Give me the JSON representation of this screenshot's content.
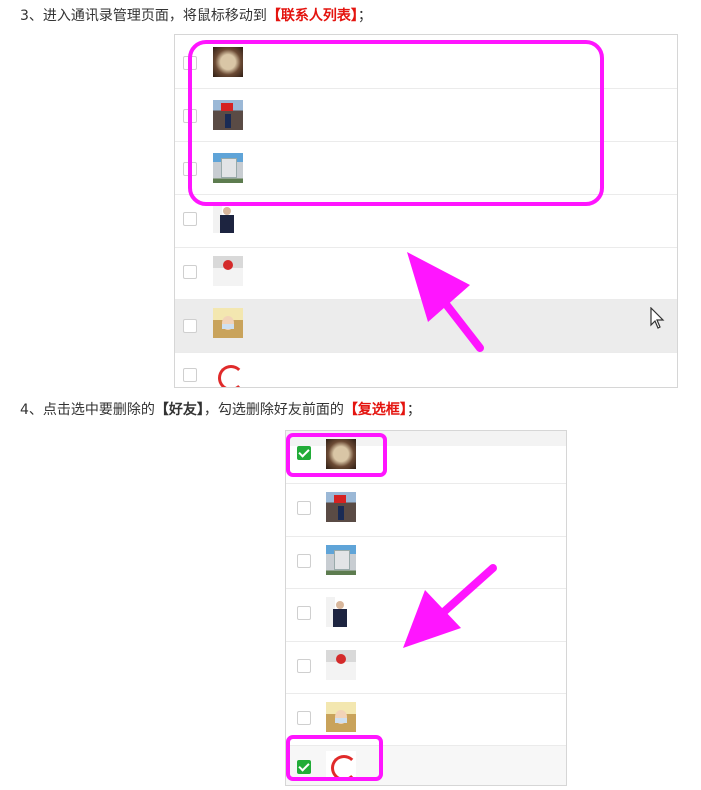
{
  "step3": {
    "prefix": "3、进入通讯录管理页面，将鼠标移动到",
    "highlight": "【联系人列表】",
    "suffix": "；"
  },
  "step4": {
    "prefix": "4、点击选中要删除的",
    "bold": "【好友】",
    "middle": "，勾选删除好友前面的",
    "highlight": "【复选框】",
    "suffix": "；"
  },
  "colors": {
    "highlight_text": "#e4140f",
    "annotation_magenta": "#ff15ff",
    "checkbox_checked": "#22ac38"
  },
  "contacts": [
    {
      "avatar": "egg-avatar"
    },
    {
      "avatar": "flag-avatar"
    },
    {
      "avatar": "monument-avatar"
    },
    {
      "avatar": "person-avatar"
    },
    {
      "avatar": "logo-avatar"
    },
    {
      "avatar": "face-mask-avatar"
    },
    {
      "avatar": "red-logo-avatar"
    }
  ],
  "list_b_checked": [
    true,
    false,
    false,
    false,
    false,
    false,
    true
  ]
}
